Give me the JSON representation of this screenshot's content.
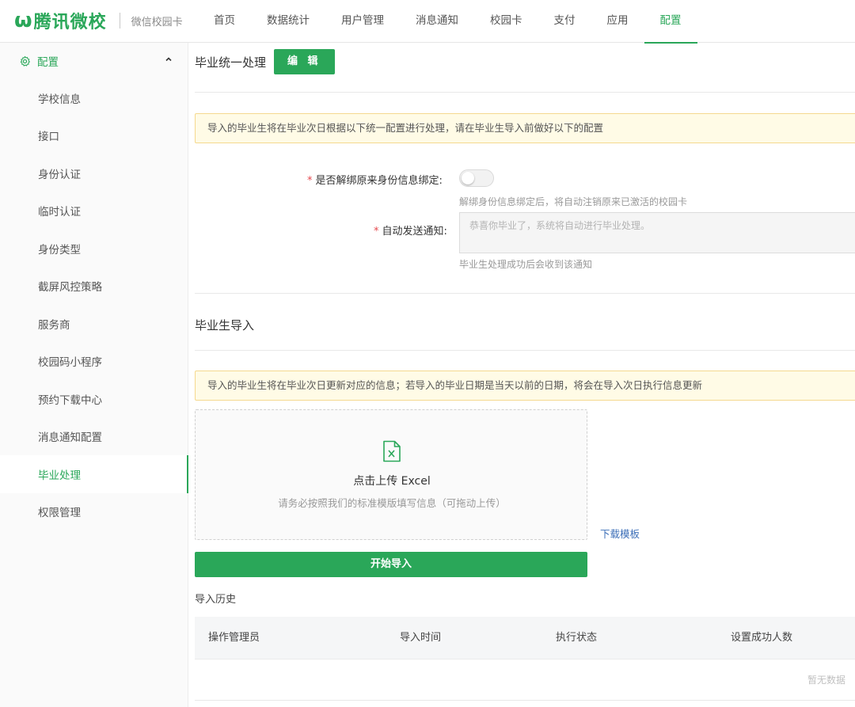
{
  "header": {
    "brand_mark": "ѡ",
    "brand": "腾讯微校",
    "product": "微信校园卡",
    "accent": "#2aa759",
    "nav": [
      {
        "label": "首页"
      },
      {
        "label": "数据统计"
      },
      {
        "label": "用户管理"
      },
      {
        "label": "消息通知"
      },
      {
        "label": "校园卡"
      },
      {
        "label": "支付"
      },
      {
        "label": "应用"
      },
      {
        "label": "配置"
      }
    ],
    "active_nav": "配置"
  },
  "sidebar": {
    "group_label": "配置",
    "group_icon": "gear-icon",
    "items": [
      {
        "label": "学校信息"
      },
      {
        "label": "接口"
      },
      {
        "label": "身份认证"
      },
      {
        "label": "临时认证"
      },
      {
        "label": "身份类型"
      },
      {
        "label": "截屏风控策略"
      },
      {
        "label": "服务商"
      },
      {
        "label": "校园码小程序"
      },
      {
        "label": "预约下载中心"
      },
      {
        "label": "消息通知配置"
      },
      {
        "label": "毕业处理"
      },
      {
        "label": "权限管理"
      }
    ],
    "active_item": "毕业处理"
  },
  "graduation": {
    "title": "毕业统一处理",
    "edit_label": "编 辑",
    "notice": "导入的毕业生将在毕业次日根据以下统一配置进行处理，请在毕业生导入前做好以下的配置",
    "unbind_label": "是否解绑原来身份信息绑定:",
    "unbind_enabled": false,
    "unbind_help": "解绑身份信息绑定后，将自动注销原来已激活的校园卡",
    "notify_label": "自动发送通知:",
    "notify_value": "恭喜你毕业了，系统将自动进行毕业处理。",
    "notify_help": "毕业生处理成功后会收到该通知",
    "required_mark": "*"
  },
  "import": {
    "title": "毕业生导入",
    "notice": "导入的毕业生将在毕业次日更新对应的信息；若导入的毕业日期是当天以前的日期，将会在导入次日执行信息更新",
    "upload_title": "点击上传 Excel",
    "upload_hint": "请务必按照我们的标准模版填写信息（可拖动上传）",
    "upload_icon": "excel-file-icon",
    "download_template": "下载模板",
    "start_button": "开始导入"
  },
  "history": {
    "title": "导入历史",
    "columns": [
      "操作管理员",
      "导入时间",
      "执行状态",
      "设置成功人数"
    ],
    "empty_text": "暂无数据"
  }
}
